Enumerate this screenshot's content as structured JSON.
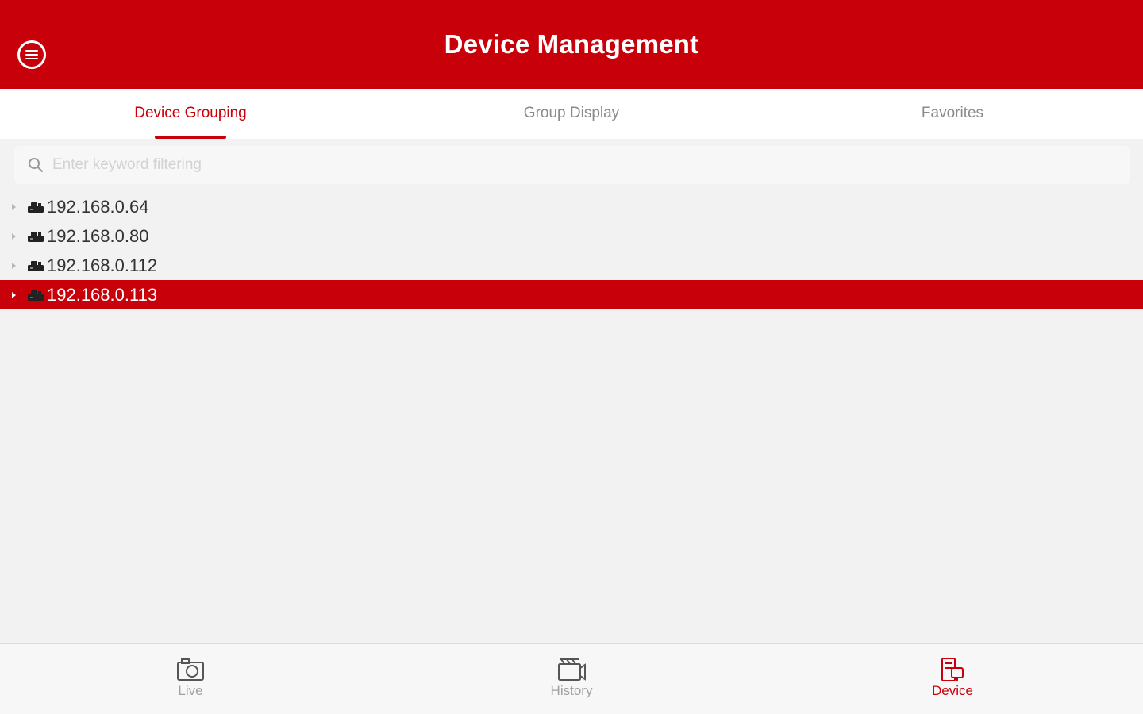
{
  "header": {
    "title": "Device Management",
    "menu_icon": "menu-icon"
  },
  "tabs": [
    {
      "label": "Device Grouping",
      "active": true
    },
    {
      "label": "Group Display",
      "active": false
    },
    {
      "label": "Favorites",
      "active": false
    }
  ],
  "search": {
    "placeholder": "Enter keyword filtering",
    "value": ""
  },
  "devices": [
    {
      "label": "192.168.0.64",
      "selected": false
    },
    {
      "label": "192.168.0.80",
      "selected": false
    },
    {
      "label": "192.168.0.112",
      "selected": false
    },
    {
      "label": "192.168.0.113",
      "selected": true
    }
  ],
  "bottom_nav": [
    {
      "label": "Live",
      "icon": "camera-icon",
      "active": false
    },
    {
      "label": "History",
      "icon": "video-icon",
      "active": false
    },
    {
      "label": "Device",
      "icon": "device-icon",
      "active": true
    }
  ],
  "colors": {
    "accent": "#c8000a",
    "background": "#f2f2f2",
    "inactive_text": "#8a8a8a"
  }
}
